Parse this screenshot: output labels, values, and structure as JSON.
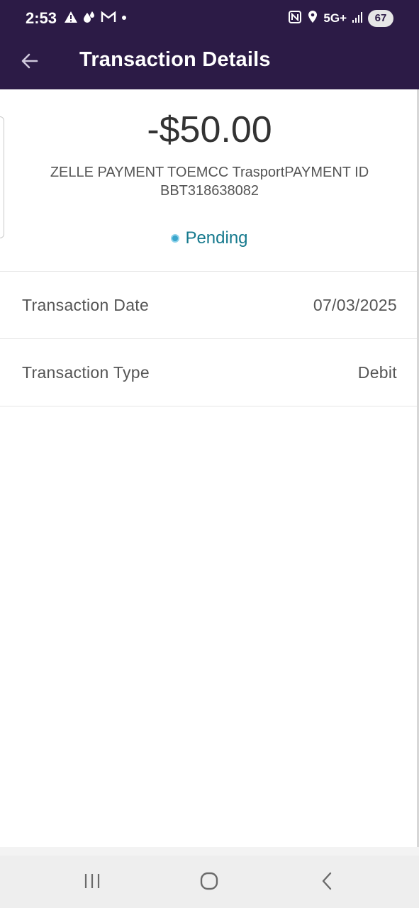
{
  "status_bar": {
    "time": "2:53",
    "left_icons": [
      "warning-icon",
      "drops-icon",
      "mail-icon",
      "dot-icon"
    ],
    "right_icons": [
      "nfc-icon",
      "location-icon",
      "signal-icon"
    ],
    "network": "5G+",
    "battery": "67"
  },
  "app_bar": {
    "back_icon": "arrow-back-icon",
    "title": "Transaction Details"
  },
  "transaction": {
    "amount": "-$50.00",
    "description": "ZELLE PAYMENT TOEMCC TrasportPAYMENT ID BBT318638082",
    "status": "Pending",
    "details": [
      {
        "label": "Transaction Date",
        "value": "07/03/2025"
      },
      {
        "label": "Transaction Type",
        "value": "Debit"
      }
    ]
  },
  "nav_bar": {
    "buttons": [
      "recents-icon",
      "home-icon",
      "back-icon"
    ]
  },
  "colors": {
    "header": "#2c1b46",
    "pending": "#15798d",
    "text": "#555555"
  }
}
